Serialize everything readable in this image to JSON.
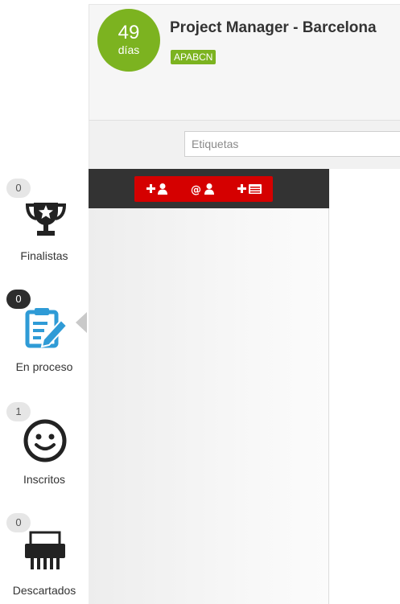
{
  "job": {
    "days_number": "49",
    "days_label": "días",
    "title": "Project Manager - Barcelona",
    "tag": "APABCN"
  },
  "filters": {
    "tags_placeholder": "Etiquetas"
  },
  "actions": [
    {
      "name": "add-candidate",
      "icon": "plus-user-icon"
    },
    {
      "name": "email-candidate",
      "icon": "at-user-icon"
    },
    {
      "name": "add-form",
      "icon": "plus-card-icon"
    }
  ],
  "stages": [
    {
      "label": "Finalistas",
      "count": "0",
      "icon": "trophy-icon",
      "active": false
    },
    {
      "label": "En proceso",
      "count": "0",
      "icon": "edit-document-icon",
      "active": true
    },
    {
      "label": "Inscritos",
      "count": "1",
      "icon": "smiley-icon",
      "active": false
    },
    {
      "label": "Descartados",
      "count": "0",
      "icon": "shredder-icon",
      "active": false
    }
  ],
  "colors": {
    "accent_green": "#7cb320",
    "action_red": "#d50000",
    "active_icon_blue": "#2f9bd6",
    "dark_header": "#333333"
  }
}
